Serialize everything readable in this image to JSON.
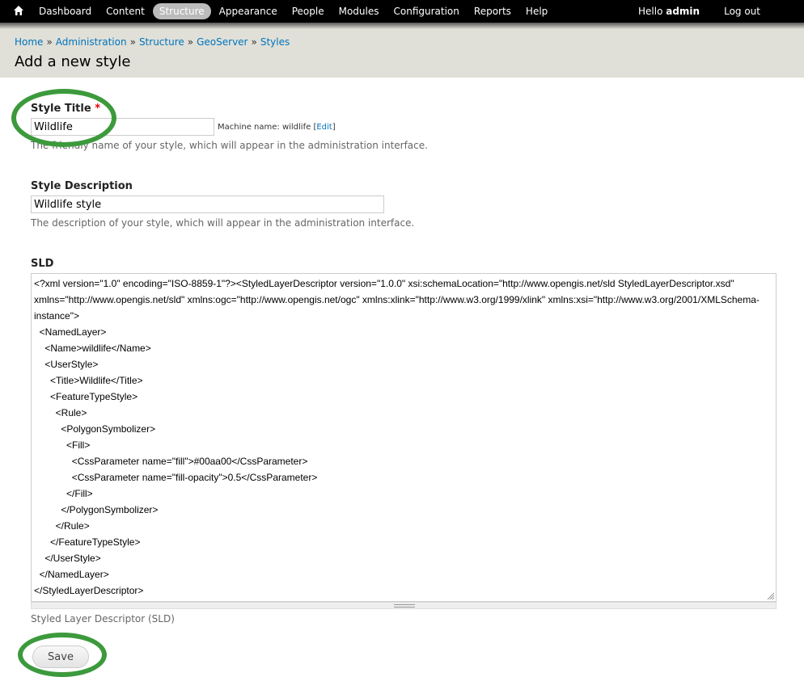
{
  "toolbar": {
    "home_icon": "home-icon",
    "items": [
      {
        "label": "Dashboard",
        "active": false
      },
      {
        "label": "Content",
        "active": false
      },
      {
        "label": "Structure",
        "active": true
      },
      {
        "label": "Appearance",
        "active": false
      },
      {
        "label": "People",
        "active": false
      },
      {
        "label": "Modules",
        "active": false
      },
      {
        "label": "Configuration",
        "active": false
      },
      {
        "label": "Reports",
        "active": false
      },
      {
        "label": "Help",
        "active": false
      }
    ],
    "hello_prefix": "Hello ",
    "username": "admin",
    "logout": "Log out"
  },
  "breadcrumb": [
    "Home",
    "Administration",
    "Structure",
    "GeoServer",
    "Styles"
  ],
  "breadcrumb_separator": "»",
  "page_title": "Add a new style",
  "form": {
    "style_title": {
      "label": "Style Title",
      "required_mark": "*",
      "value": "Wildlife",
      "machine_name_prefix": "Machine name: wildlife [",
      "machine_name_edit": "Edit",
      "machine_name_suffix": "]",
      "description": "The friendly name of your style, which will appear in the administration interface."
    },
    "style_description": {
      "label": "Style Description",
      "value": "Wildlife style",
      "description": "The description of your style, which will appear in the administration interface."
    },
    "sld": {
      "label": "SLD",
      "value": "<?xml version=\"1.0\" encoding=\"ISO-8859-1\"?><StyledLayerDescriptor version=\"1.0.0\" xsi:schemaLocation=\"http://www.opengis.net/sld StyledLayerDescriptor.xsd\" xmlns=\"http://www.opengis.net/sld\" xmlns:ogc=\"http://www.opengis.net/ogc\" xmlns:xlink=\"http://www.w3.org/1999/xlink\" xmlns:xsi=\"http://www.w3.org/2001/XMLSchema-instance\">\n  <NamedLayer>\n    <Name>wildlife</Name>\n    <UserStyle>\n      <Title>Wildlife</Title>\n      <FeatureTypeStyle>\n        <Rule>\n          <PolygonSymbolizer>\n            <Fill>\n              <CssParameter name=\"fill\">#00aa00</CssParameter>\n              <CssParameter name=\"fill-opacity\">0.5</CssParameter>\n            </Fill>\n          </PolygonSymbolizer>\n        </Rule>\n      </FeatureTypeStyle>\n    </UserStyle>\n  </NamedLayer>\n</StyledLayerDescriptor>",
      "description": "Styled Layer Descriptor (SLD)"
    },
    "save_label": "Save"
  },
  "colors": {
    "annotation_circle": "#3c9a3c",
    "link": "#0074bd",
    "toolbar_bg": "#000000",
    "header_bg": "#e0e0d8"
  }
}
